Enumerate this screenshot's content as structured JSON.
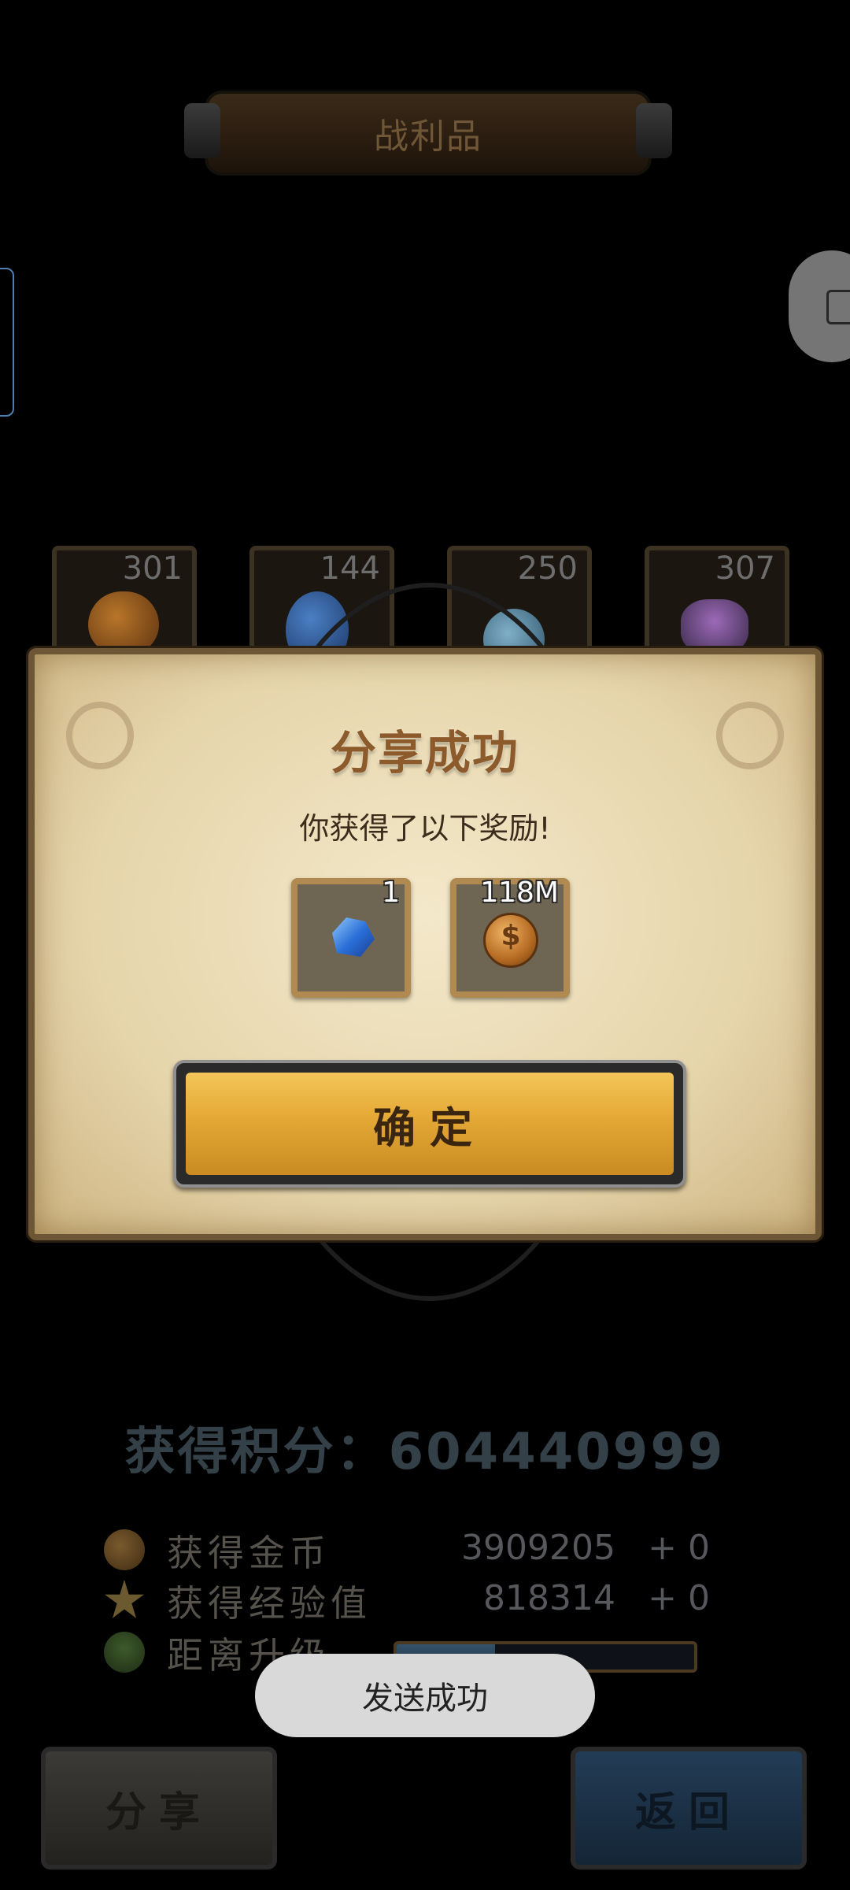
{
  "header": {
    "title": "战利品"
  },
  "loot_items": [
    {
      "name": "pumpkin",
      "count": "301"
    },
    {
      "name": "egg",
      "count": "144"
    },
    {
      "name": "potion",
      "count": "250"
    },
    {
      "name": "flower",
      "count": "307"
    }
  ],
  "dialog": {
    "title": "分享成功",
    "subtitle": "你获得了以下奖励!",
    "rewards": [
      {
        "icon": "crystal-icon",
        "count": "1"
      },
      {
        "icon": "coin-icon",
        "count": "118M"
      }
    ],
    "confirm_label": "确定"
  },
  "score": {
    "text": "获得积分：604440999"
  },
  "stats": {
    "gold": {
      "label": "获得金币",
      "value": "3909205",
      "add": "+ 0"
    },
    "exp": {
      "label": "获得经验值",
      "value": "818314",
      "add": "+ 0"
    },
    "level": {
      "label": "距离升级",
      "progress": 0.33
    }
  },
  "buttons": {
    "share_label": "分享",
    "back_label": "返回"
  },
  "toast": {
    "text": "发送成功"
  }
}
